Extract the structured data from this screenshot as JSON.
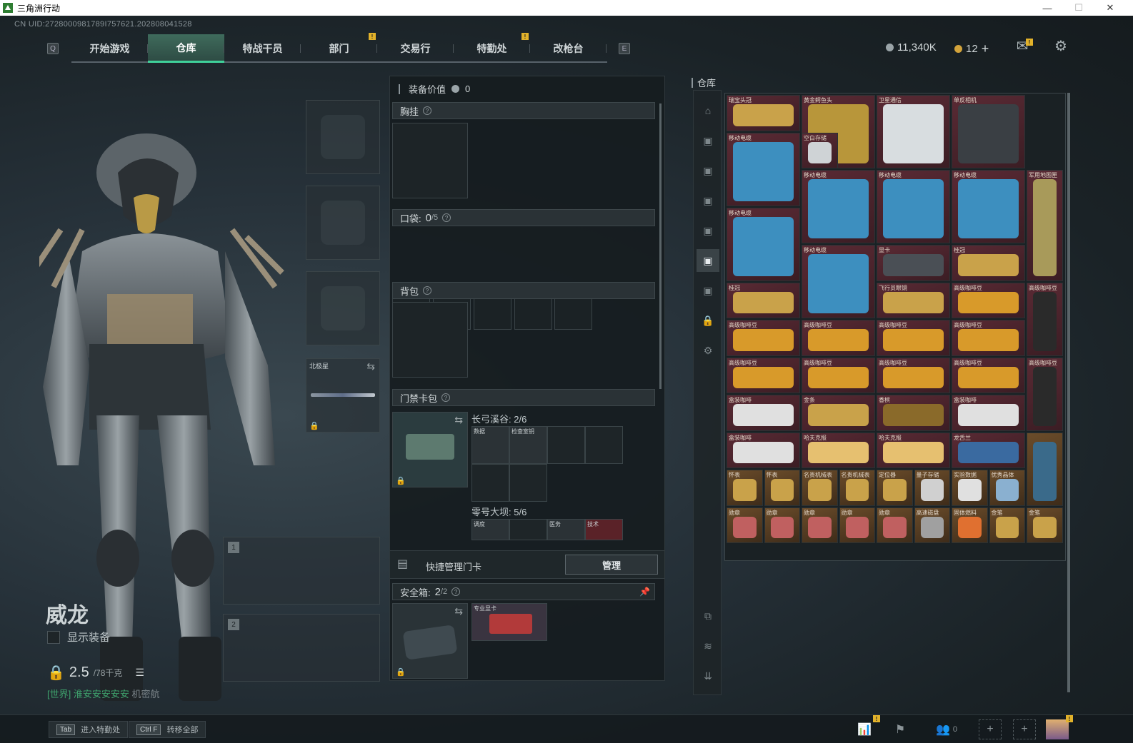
{
  "window": {
    "title": "三角洲行动",
    "min": "—",
    "max": "☐",
    "close": "✕"
  },
  "uid": "CN UID:2728000981789I757621.202808041528",
  "keys": {
    "left": "Q",
    "right": "E"
  },
  "nav": {
    "tabs": [
      "开始游戏",
      "仓库",
      "特战干员",
      "部门",
      "交易行",
      "特勤处",
      "改枪台"
    ],
    "active": 1
  },
  "currency": {
    "coins": "11,340K",
    "premium": "12"
  },
  "operator": {
    "name": "威龙",
    "show_equipment": "显示装备",
    "weight": "2.5",
    "weight_max": "/78千克"
  },
  "chat": {
    "channel": "[世界]",
    "user": "淮安安安安安",
    "text": "机密航"
  },
  "bottom": {
    "hints": [
      {
        "key": "Tab",
        "label": "进入特勤处"
      },
      {
        "key": "Ctrl F",
        "label": "转移全部"
      }
    ],
    "friends": "0"
  },
  "slots": {
    "melee_name": "北极星",
    "weapon1": "1",
    "weapon2": "2"
  },
  "equip": {
    "value_label": "装备价值",
    "value": "0",
    "chest": "胸挂",
    "pocket_label": "口袋:",
    "pocket_count": "0",
    "pocket_total": "/5",
    "backpack": "背包",
    "keycard": "门禁卡包",
    "map1": "长弓溪谷: 2/6",
    "map2": "零号大坝: 5/6",
    "map1_items": [
      "数据",
      "检查室钥"
    ],
    "map2_items": [
      "调度",
      "医务",
      "技术"
    ],
    "quick_manage": "快捷管理门卡",
    "manage": "管理",
    "safebox_label": "安全箱:",
    "safebox_count": "2",
    "safebox_total": "/2",
    "safebox_item": "专业显卡"
  },
  "stash": {
    "title": "仓库",
    "items": [
      {
        "label": "瑞宝头冠",
        "c": "red"
      },
      {
        "label": "黄金鳄鱼头",
        "c": "red"
      },
      {
        "label": "卫星通信",
        "c": "red"
      },
      {
        "label": "单反相机",
        "c": "red"
      },
      {
        "label": "移动电缆",
        "c": "red"
      },
      {
        "label": "空白存储",
        "c": "red"
      },
      {
        "label": "移动电缆",
        "c": "red"
      },
      {
        "label": "移动电缆",
        "c": "red"
      },
      {
        "label": "移动电缆",
        "c": "red"
      },
      {
        "label": "军用地图匣",
        "c": "red"
      },
      {
        "label": "移动电缆",
        "c": "red"
      },
      {
        "label": "移动电缆",
        "c": "red"
      },
      {
        "label": "显卡",
        "c": "red"
      },
      {
        "label": "桂冠",
        "c": "red"
      },
      {
        "label": "桂冠",
        "c": "red"
      },
      {
        "label": "飞行员眼镜",
        "c": "red"
      },
      {
        "label": "高级咖啡豆",
        "c": "red"
      },
      {
        "label": "高级咖啡豆",
        "c": "red"
      },
      {
        "label": "高级咖啡豆",
        "c": "red"
      },
      {
        "label": "高级咖啡豆",
        "c": "red"
      },
      {
        "label": "高级咖啡豆",
        "c": "red"
      },
      {
        "label": "高级咖啡豆",
        "c": "red"
      },
      {
        "label": "高级咖啡豆",
        "c": "red"
      },
      {
        "label": "高级咖啡豆",
        "c": "red"
      },
      {
        "label": "高级咖啡豆",
        "c": "red"
      },
      {
        "label": "高级咖啡豆",
        "c": "red"
      },
      {
        "label": "高级咖啡豆",
        "c": "red"
      },
      {
        "label": "金条",
        "c": "red"
      },
      {
        "label": "香槟",
        "c": "red"
      },
      {
        "label": "盒装咖啡",
        "c": "red"
      },
      {
        "label": "盒装咖啡",
        "c": "red"
      },
      {
        "label": "盒装咖啡",
        "c": "red"
      },
      {
        "label": "哈夫克报",
        "c": "red"
      },
      {
        "label": "哈夫克报",
        "c": "red"
      },
      {
        "label": "龙舌兰",
        "c": "red"
      },
      {
        "label": "怀表",
        "c": "gold"
      },
      {
        "label": "怀表",
        "c": "gold"
      },
      {
        "label": "名贵机械表",
        "c": "gold"
      },
      {
        "label": "名贵机械表",
        "c": "gold"
      },
      {
        "label": "定位器",
        "c": "gold"
      },
      {
        "label": "量子存储",
        "c": "gold"
      },
      {
        "label": "实验数据",
        "c": "gold"
      },
      {
        "label": "优秀晶体",
        "c": "gold"
      },
      {
        "label": "",
        "c": "gold"
      },
      {
        "label": "勋章",
        "c": "gold"
      },
      {
        "label": "勋章",
        "c": "gold"
      },
      {
        "label": "勋章",
        "c": "gold"
      },
      {
        "label": "勋章",
        "c": "gold"
      },
      {
        "label": "勋章",
        "c": "gold"
      },
      {
        "label": "高速磁盘",
        "c": "gold"
      },
      {
        "label": "固体燃料",
        "c": "gold"
      },
      {
        "label": "金笔",
        "c": "gold"
      },
      {
        "label": "金笔",
        "c": "gold"
      }
    ]
  }
}
